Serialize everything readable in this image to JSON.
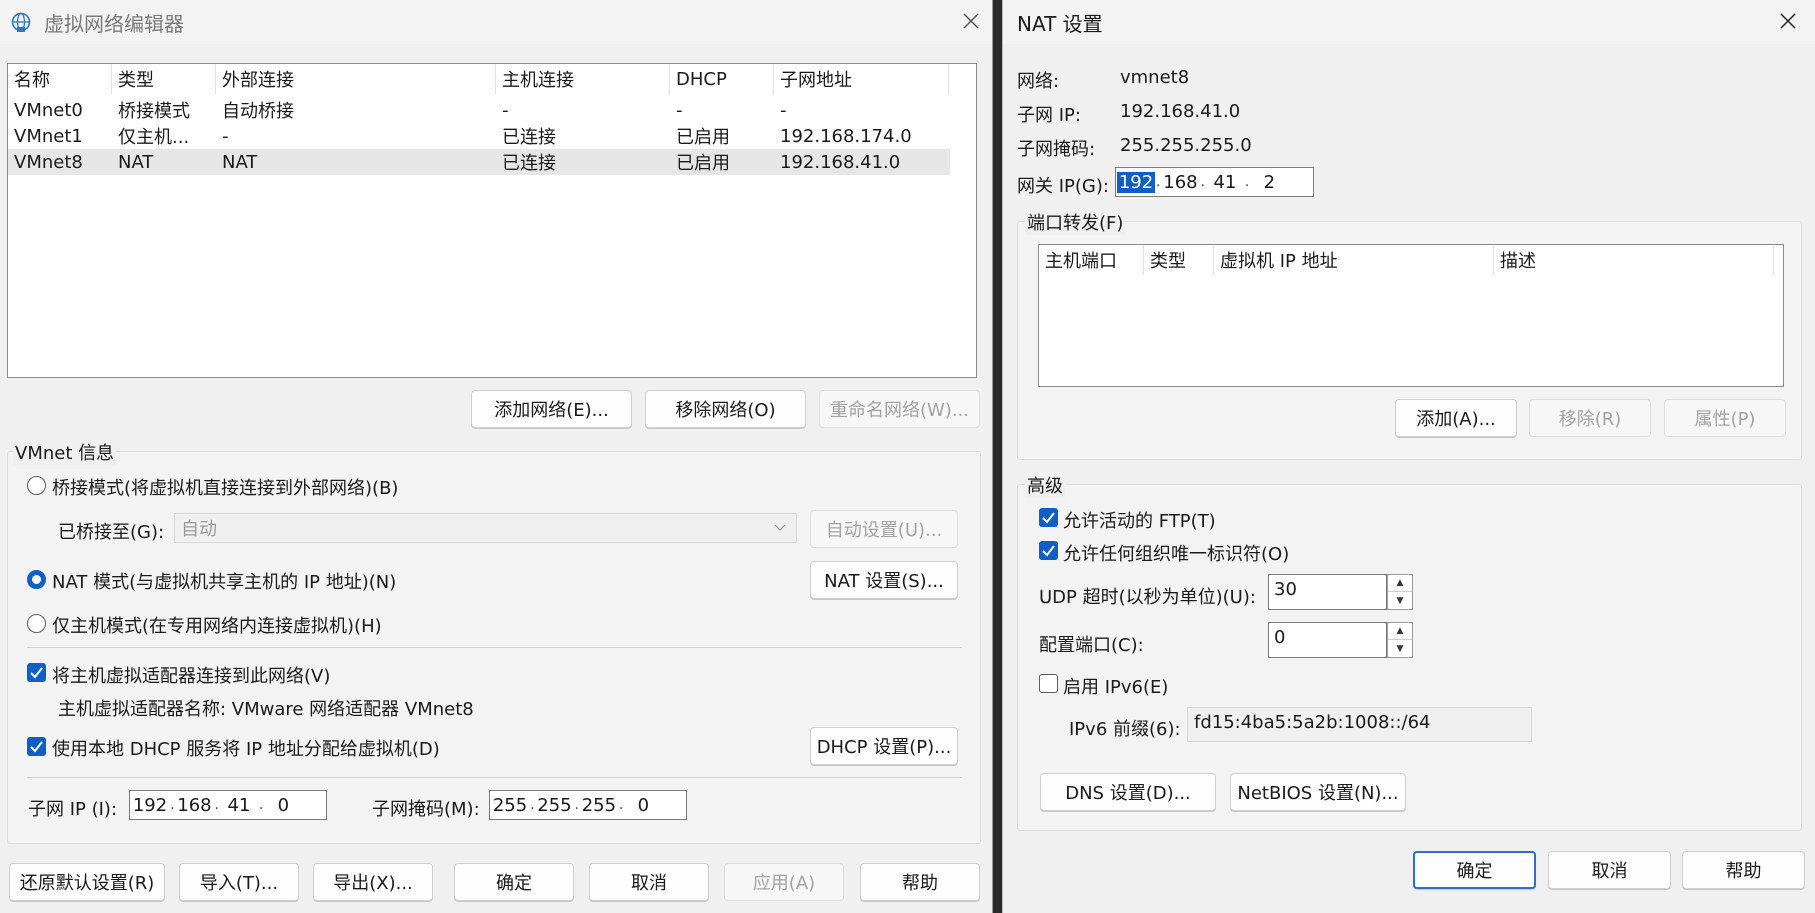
{
  "left": {
    "title": "虚拟网络编辑器",
    "table": {
      "headers": [
        "名称",
        "类型",
        "外部连接",
        "主机连接",
        "DHCP",
        "子网地址"
      ],
      "rows": [
        [
          "VMnet0",
          "桥接模式",
          "自动桥接",
          "-",
          "-",
          "-"
        ],
        [
          "VMnet1",
          "仅主机...",
          "-",
          "已连接",
          "已启用",
          "192.168.174.0"
        ],
        [
          "VMnet8",
          "NAT",
          "NAT",
          "已连接",
          "已启用",
          "192.168.41.0"
        ]
      ]
    },
    "buttons": {
      "add_network": "添加网络(E)...",
      "remove_network": "移除网络(O)",
      "rename_network": "重命名网络(W)..."
    },
    "vmnet_info": {
      "legend": "VMnet 信息",
      "bridged_mode": "桥接模式(将虚拟机直接连接到外部网络)(B)",
      "bridged_to_label": "已桥接至(G):",
      "bridged_to_value": "自动",
      "auto_settings": "自动设置(U)...",
      "nat_mode": "NAT 模式(与虚拟机共享主机的 IP 地址)(N)",
      "nat_settings": "NAT 设置(S)...",
      "host_only_mode": "仅主机模式(在专用网络内连接虚拟机)(H)",
      "connect_adapter": "将主机虚拟适配器连接到此网络(V)",
      "adapter_name": "主机虚拟适配器名称: VMware 网络适配器 VMnet8",
      "use_dhcp": "使用本地 DHCP 服务将 IP 地址分配给虚拟机(D)",
      "dhcp_settings": "DHCP 设置(P)...",
      "subnet_ip_label": "子网 IP (I):",
      "subnet_ip": [
        "192",
        "168",
        "41",
        "0"
      ],
      "subnet_mask_label": "子网掩码(M):",
      "subnet_mask": [
        "255",
        "255",
        "255",
        "0"
      ]
    },
    "footer": {
      "restore": "还原默认设置(R)",
      "import": "导入(T)...",
      "export": "导出(X)...",
      "ok": "确定",
      "cancel": "取消",
      "apply": "应用(A)",
      "help": "帮助"
    }
  },
  "right": {
    "title": "NAT 设置",
    "network_label": "网络:",
    "network_value": "vmnet8",
    "subnet_ip_label": "子网 IP:",
    "subnet_ip_value": "192.168.41.0",
    "subnet_mask_label": "子网掩码:",
    "subnet_mask_value": "255.255.255.0",
    "gateway_label": "网关 IP(G):",
    "gateway": [
      "192",
      "168",
      "41",
      "2"
    ],
    "port_forward": {
      "legend": "端口转发(F)",
      "headers": [
        "主机端口",
        "类型",
        "虚拟机 IP 地址",
        "描述"
      ],
      "add": "添加(A)...",
      "remove": "移除(R)",
      "properties": "属性(P)"
    },
    "advanced": {
      "legend": "高级",
      "allow_ftp": "允许活动的 FTP(T)",
      "allow_uuid": "允许任何组织唯一标识符(O)",
      "udp_label": "UDP 超时(以秒为单位)(U):",
      "udp_value": "30",
      "config_port_label": "配置端口(C):",
      "config_port_value": "0",
      "enable_ipv6": "启用 IPv6(E)",
      "ipv6_prefix_label": "IPv6 前缀(6):",
      "ipv6_prefix_value": "fd15:4ba5:5a2b:1008::/64",
      "dns_settings": "DNS 设置(D)...",
      "netbios_settings": "NetBIOS 设置(N)..."
    },
    "footer": {
      "ok": "确定",
      "cancel": "取消",
      "help": "帮助"
    }
  }
}
